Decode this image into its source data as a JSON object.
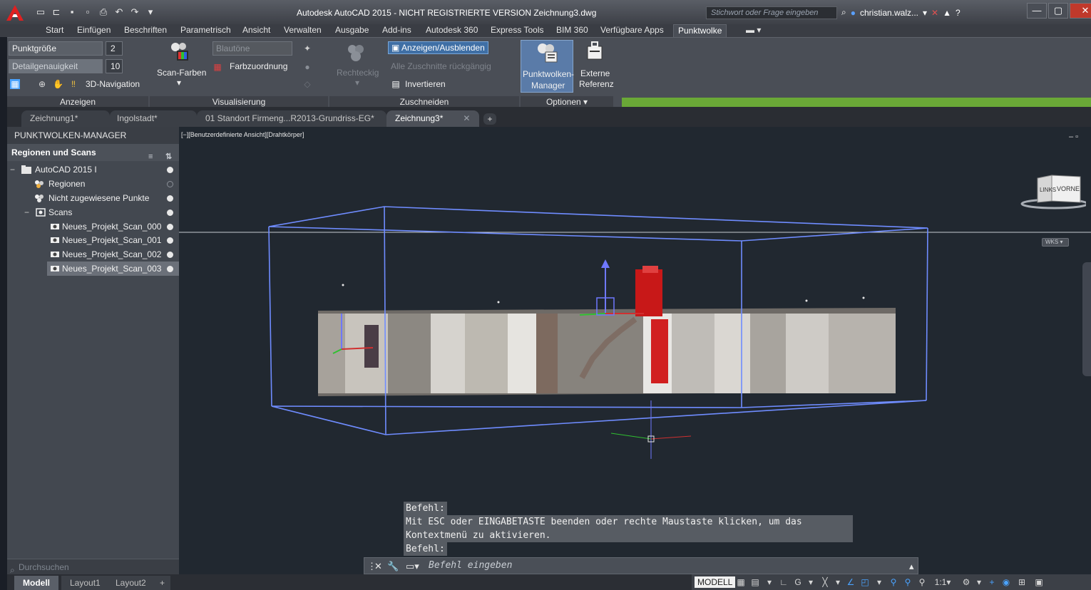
{
  "window": {
    "title": "Autodesk AutoCAD 2015 - NICHT REGISTRIERTE VERSION   Zeichnung3.dwg",
    "search_placeholder": "Stichwort oder Frage eingeben",
    "user": "christian.walz..."
  },
  "ribbon_tabs": [
    "Start",
    "Einfügen",
    "Beschriften",
    "Parametrisch",
    "Ansicht",
    "Verwalten",
    "Ausgabe",
    "Add-ins",
    "Autodesk 360",
    "Express Tools",
    "BIM 360",
    "Verfügbare Apps",
    "Punktwolke"
  ],
  "ribbon": {
    "anzeigen": {
      "title": "Anzeigen",
      "punktgroesse_label": "Punktgröße",
      "punktgroesse_value": "2",
      "detail_label": "Detailgenauigkeit",
      "detail_value": "10",
      "nav_label": "3D-Navigation"
    },
    "visualisierung": {
      "title": "Visualisierung",
      "scan_farben": "Scan-Farben",
      "farbschema": "Blautöne",
      "farbzuordnung": "Farbzuordnung"
    },
    "zuschneiden": {
      "title": "Zuschneiden",
      "rechteckig": "Rechteckig",
      "anzeigen_ausblenden": "Anzeigen/Ausblenden",
      "alle_rueckgaengig": "Alle Zuschnitte rückgängig",
      "invertieren": "Invertieren"
    },
    "optionen": {
      "title": "Optionen",
      "manager_line1": "Punktwolken-",
      "manager_line2": "Manager",
      "extern_line1": "Externe",
      "extern_line2": "Referenz"
    }
  },
  "doc_tabs": [
    "Zeichnung1*",
    "Ingolstadt*",
    "01 Standort Firmeng...R2013-Grundriss-EG*",
    "Zeichnung3*"
  ],
  "sidebar": {
    "title": "PUNKTWOLKEN-MANAGER",
    "section": "Regionen und Scans",
    "tree": [
      {
        "label": "AutoCAD 2015 I"
      },
      {
        "label": "Regionen"
      },
      {
        "label": "Nicht zugewiesene Punkte"
      },
      {
        "label": "Scans"
      },
      {
        "label": "Neues_Projekt_Scan_000"
      },
      {
        "label": "Neues_Projekt_Scan_001"
      },
      {
        "label": "Neues_Projekt_Scan_002"
      },
      {
        "label": "Neues_Projekt_Scan_003"
      }
    ],
    "search_placeholder": "Durchsuchen"
  },
  "viewport": {
    "label": "[−][Benutzerdefinierte Ansicht][Drahtkörper]",
    "viewcube_left": "LINKS",
    "viewcube_front": "VORNE",
    "wcs": "WKS"
  },
  "command": {
    "history": [
      "Befehl:",
      "Mit ESC oder EINGABETASTE beenden oder rechte Maustaste klicken, um das",
      "Kontextmenü zu aktivieren.",
      "Befehl:"
    ],
    "placeholder": "Befehl eingeben"
  },
  "layout_tabs": [
    "Modell",
    "Layout1",
    "Layout2"
  ],
  "status": {
    "modell": "MODELL",
    "scale": "1:1"
  },
  "colors": {
    "accent": "#6aa837",
    "selection": "#3f6fa5",
    "bounding_box": "#6f8cff"
  }
}
